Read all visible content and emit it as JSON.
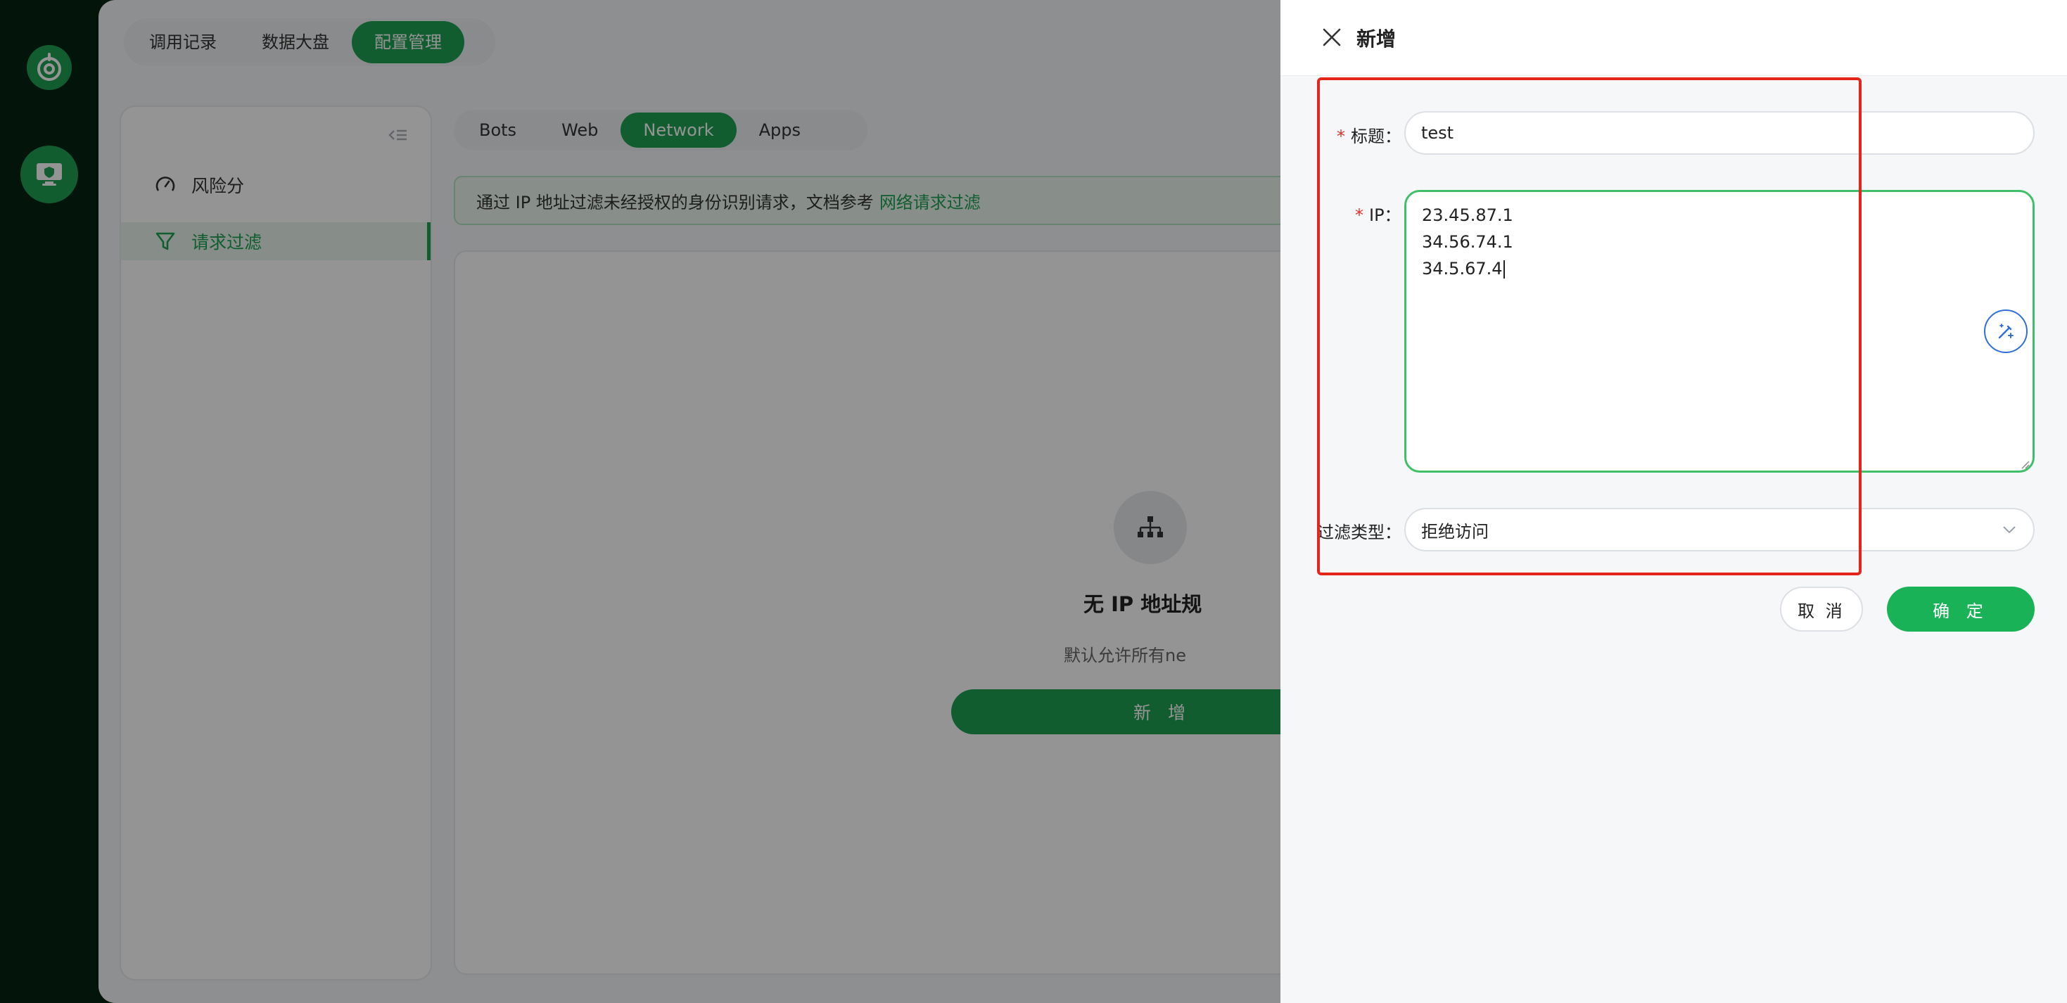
{
  "top_nav": {
    "items": [
      {
        "label": "调用记录",
        "active": false
      },
      {
        "label": "数据大盘",
        "active": false
      },
      {
        "label": "配置管理",
        "active": true
      }
    ]
  },
  "sidebar": {
    "items": [
      {
        "label": "风险分",
        "icon": "gauge-icon",
        "active": false
      },
      {
        "label": "请求过滤",
        "icon": "filter-icon",
        "active": true
      }
    ]
  },
  "sub_tabs": [
    {
      "label": "Bots",
      "active": false
    },
    {
      "label": "Web",
      "active": false
    },
    {
      "label": "Network",
      "active": true
    },
    {
      "label": "Apps",
      "active": false
    }
  ],
  "info_bar": {
    "text": "通过 IP 地址过滤未经授权的身份识别请求，文档参考",
    "link": "网络请求过滤"
  },
  "empty_state": {
    "title": "无 IP 地址规",
    "description": "默认允许所有ne",
    "add_button": "新 增"
  },
  "drawer": {
    "title": "新增",
    "fields": {
      "title_label": "标题：",
      "title_value": "test",
      "ip_label": "IP：",
      "ip_lines": [
        "23.45.87.1",
        "34.56.74.1",
        "34.5.67.4"
      ],
      "filter_type_label": "过滤类型：",
      "filter_type_value": "拒绝访问"
    },
    "cancel_button": "取 消",
    "confirm_button": "确 定"
  },
  "colors": {
    "accent": "#1ea152",
    "highlight_box": "#e5251b"
  }
}
